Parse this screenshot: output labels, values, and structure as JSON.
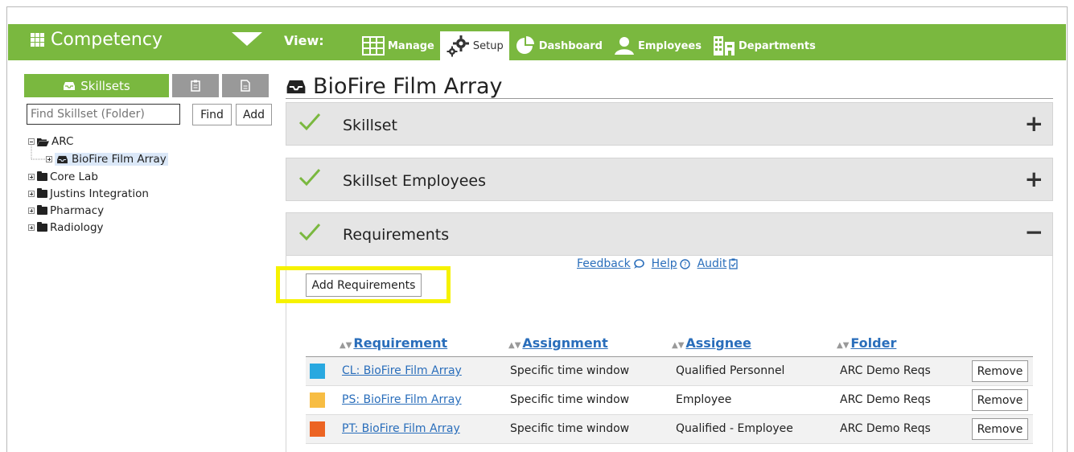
{
  "app": {
    "title": "Competency"
  },
  "view": {
    "label": "View:"
  },
  "nav": [
    {
      "label": "Manage",
      "icon": "table-icon"
    },
    {
      "label": "Setup",
      "icon": "gears-icon"
    },
    {
      "label": "Dashboard",
      "icon": "pie-chart-icon"
    },
    {
      "label": "Employees",
      "icon": "user-icon"
    },
    {
      "label": "Departments",
      "icon": "building-icon"
    }
  ],
  "left_panel": {
    "tabs": [
      {
        "label": "Skillsets"
      }
    ],
    "search": {
      "placeholder": "Find Skillset (Folder)"
    },
    "find_label": "Find",
    "add_label": "Add",
    "tree": [
      {
        "label": "ARC",
        "expanded": true
      },
      {
        "label": "BioFire Film Array",
        "selected": true
      },
      {
        "label": "Core Lab"
      },
      {
        "label": "Justins Integration"
      },
      {
        "label": "Pharmacy"
      },
      {
        "label": "Radiology"
      }
    ]
  },
  "main": {
    "title": "BioFire Film Array",
    "sections": [
      {
        "label": "Skillset",
        "toggle": "+"
      },
      {
        "label": "Skillset Employees",
        "toggle": "+"
      },
      {
        "label": "Requirements",
        "toggle": "−"
      }
    ],
    "links": {
      "feedback": "Feedback",
      "help": "Help",
      "audit": "Audit"
    },
    "add_requirements": "Add Requirements",
    "table": {
      "headers": [
        "Requirement",
        "Assignment",
        "Assignee",
        "Folder"
      ],
      "rows": [
        {
          "color": "#29a8e0",
          "requirement": "CL: BioFire Film Array",
          "assignment": "Specific time window",
          "assignee": "Qualified Personnel",
          "folder": "ARC Demo Reqs",
          "action": "Remove"
        },
        {
          "color": "#f7bd43",
          "requirement": "PS: BioFire Film Array",
          "assignment": "Specific time window",
          "assignee": "Employee",
          "folder": "ARC Demo Reqs",
          "action": "Remove"
        },
        {
          "color": "#ec6423",
          "requirement": "PT: BioFire Film Array",
          "assignment": "Specific time window",
          "assignee": "Qualified - Employee",
          "folder": "ARC Demo Reqs",
          "action": "Remove"
        }
      ]
    }
  },
  "colors": {
    "brand_green": "#7ab83f",
    "link_blue": "#2a6ebb",
    "highlight": "#f6f200"
  }
}
